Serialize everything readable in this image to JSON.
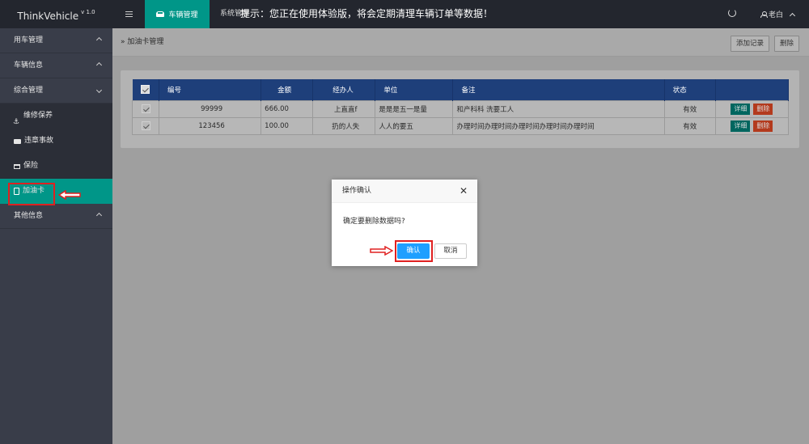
{
  "app": {
    "name": "ThinkVehicle",
    "version": "v 1.0"
  },
  "topnav": {
    "active_tab": "车辆管理",
    "system_tab": "系统管理",
    "notice": "提示：您正在使用体验版，将会定期清理车辆订单等数据！",
    "user": "老白"
  },
  "sidebar": {
    "groups": [
      {
        "label": "用车管理",
        "state": "collapsed"
      },
      {
        "label": "车辆信息",
        "state": "collapsed"
      },
      {
        "label": "综合管理",
        "state": "expanded"
      },
      {
        "label": "其他信息",
        "state": "collapsed"
      }
    ],
    "subitems": [
      {
        "label": "维修保养",
        "icon": "anchor-icon"
      },
      {
        "label": "违章事故",
        "icon": "truck-icon"
      },
      {
        "label": "保险",
        "icon": "card-icon"
      },
      {
        "label": "加油卡",
        "icon": "file-icon",
        "active": true
      }
    ]
  },
  "breadcrumb": "加油卡管理",
  "toolbar": {
    "add_label": "添加记录",
    "delete_label": "删除"
  },
  "table": {
    "headers": [
      "编号",
      "金额",
      "经办人",
      "单位",
      "备注",
      "状态"
    ],
    "rows": [
      {
        "id": "99999",
        "amount": "666.00",
        "handler": "上直直f",
        "unit": "是是是五一是量",
        "remark": "和产科科 洗要工人",
        "status": "有效"
      },
      {
        "id": "123456",
        "amount": "100.00",
        "handler": "扔的人失",
        "unit": "人人的要五",
        "remark": "办理时间办理时间办理时间办理时间办理时间",
        "status": "有效"
      }
    ],
    "detail_label": "详细",
    "delete_label": "删除"
  },
  "modal": {
    "title": "操作确认",
    "message": "确定要删除数据吗?",
    "ok_label": "确认",
    "cancel_label": "取消"
  },
  "colors": {
    "accent": "#009688",
    "header_bg": "#1e3f7a",
    "primary_button": "#1e9fff",
    "danger": "#b33a1d",
    "highlight": "#e02020"
  }
}
